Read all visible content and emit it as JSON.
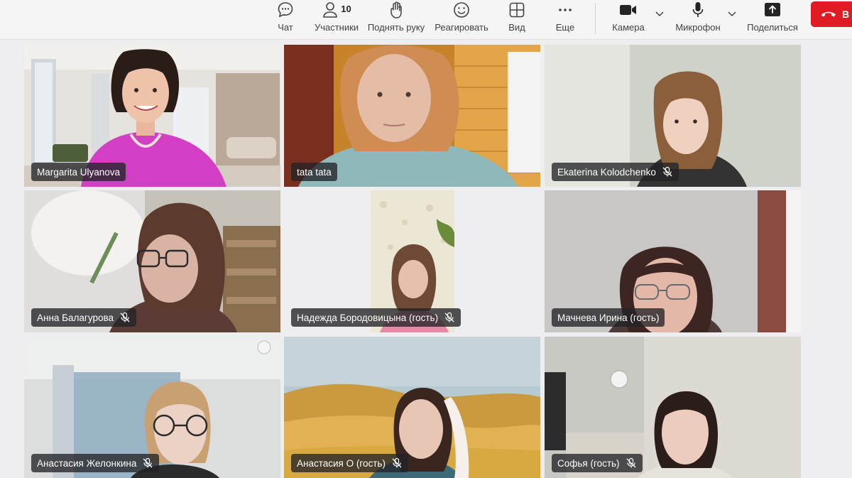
{
  "toolbar": {
    "chat": {
      "label": "Чат",
      "icon": "chat-icon"
    },
    "participants": {
      "label": "Участники",
      "count": "10",
      "icon": "people-icon"
    },
    "raise_hand": {
      "label": "Поднять руку",
      "icon": "hand-icon"
    },
    "react": {
      "label": "Реагировать",
      "icon": "smile-icon"
    },
    "view": {
      "label": "Вид",
      "icon": "grid-icon"
    },
    "more": {
      "label": "Еще",
      "icon": "more-icon"
    },
    "camera": {
      "label": "Камера",
      "icon": "camera-icon"
    },
    "microphone": {
      "label": "Микрофон",
      "icon": "microphone-icon"
    },
    "share": {
      "label": "Поделиться",
      "icon": "share-icon"
    },
    "leave": {
      "label": "В",
      "icon": "phone-hangup-icon",
      "color": "#e01b24"
    }
  },
  "participants": [
    {
      "name": "Margarita Ulyanova",
      "muted": false
    },
    {
      "name": "tata tata",
      "muted": false
    },
    {
      "name": "Ekaterina Kolodchenko",
      "muted": true
    },
    {
      "name": "Анна Балагурова",
      "muted": true
    },
    {
      "name": "Надежда Бородовицына (гость)",
      "muted": true
    },
    {
      "name": "Мачнева Ирина (гость)",
      "muted": false
    },
    {
      "name": "Анастасия Желонкина",
      "muted": true
    },
    {
      "name": "Анастасия О (гость)",
      "muted": true
    },
    {
      "name": "Софья (гость)",
      "muted": true
    }
  ]
}
